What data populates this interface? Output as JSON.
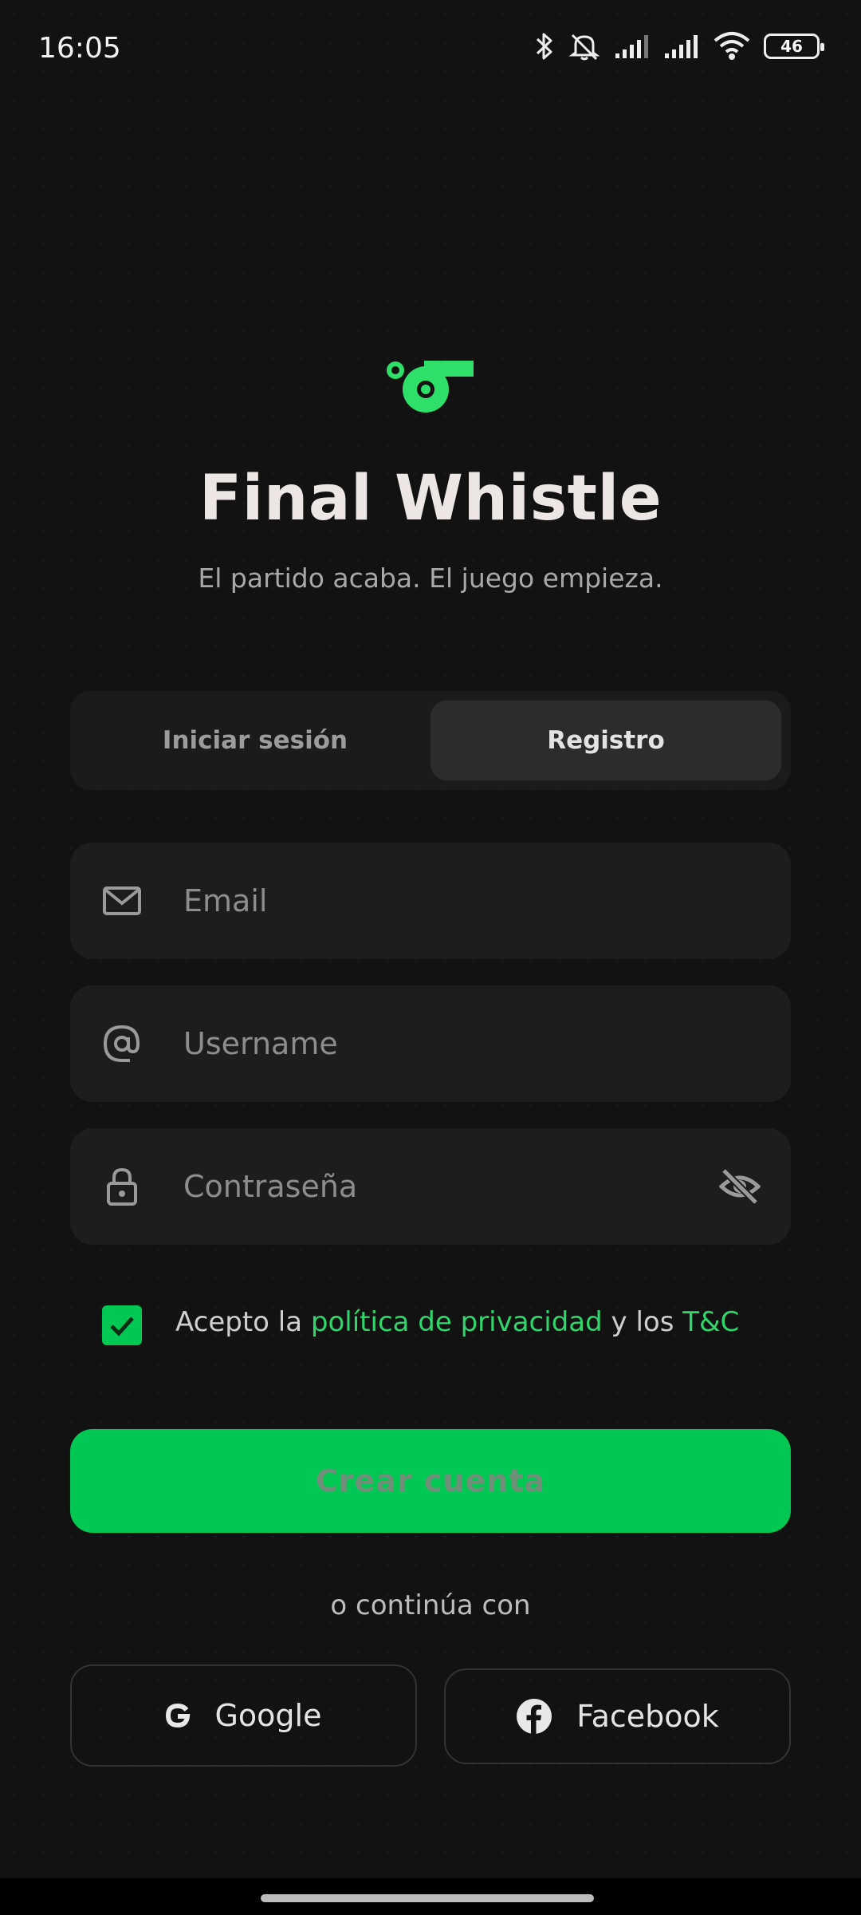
{
  "status_bar": {
    "time": "16:05",
    "battery": "46",
    "icons": [
      "bluetooth-icon",
      "mute-icon",
      "signal-icon",
      "signal-icon",
      "wifi-icon",
      "battery-icon"
    ]
  },
  "app": {
    "title": "Final Whistle",
    "subtitle": "El partido acaba. El juego empieza.",
    "logo": "whistle-icon",
    "brand_color": "#00c853"
  },
  "tabs": {
    "login": "Iniciar sesión",
    "register": "Registro",
    "active": "register"
  },
  "form": {
    "email_placeholder": "Email",
    "username_placeholder": "Username",
    "password_placeholder": "Contraseña",
    "terms_prefix": "Acepto la ",
    "privacy_link": "política de privacidad",
    "terms_middle": " y los ",
    "tc_link": "T&C",
    "terms_checked": true,
    "submit": "Crear cuenta"
  },
  "social": {
    "divider": "o continúa con",
    "google": "Google",
    "facebook": "Facebook"
  }
}
